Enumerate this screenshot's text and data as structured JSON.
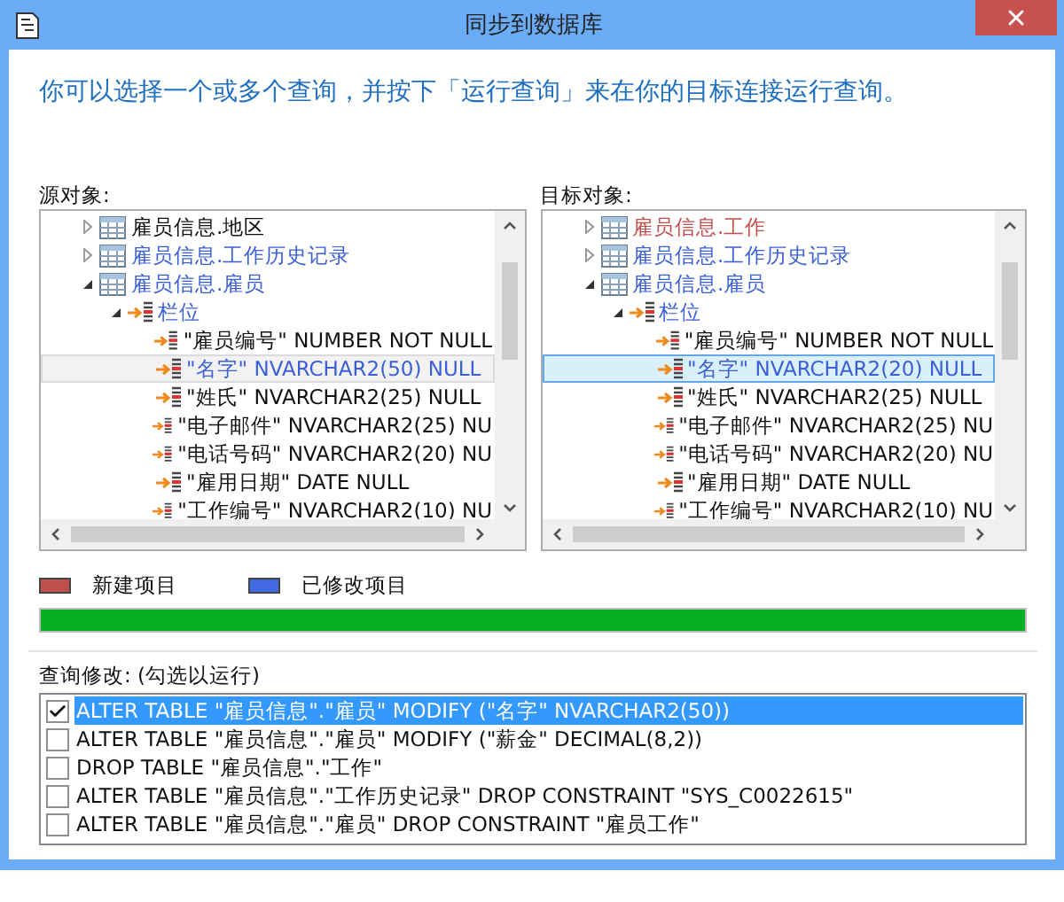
{
  "window": {
    "title": "同步到数据库"
  },
  "instruction": "你可以选择一个或多个查询，并按下「运行查询」来在你的目标连接运行查询。",
  "trees": [
    {
      "label": "源对象:",
      "focused": false,
      "nodes": [
        {
          "kind": "table",
          "label": "雇员信息.地区",
          "color": "#111111",
          "expanded": false,
          "selected": false
        },
        {
          "kind": "table",
          "label": "雇员信息.工作历史记录",
          "color": "#3b5fd6",
          "expanded": false,
          "selected": false
        },
        {
          "kind": "table",
          "label": "雇员信息.雇员",
          "color": "#3b5fd6",
          "expanded": true,
          "selected": false,
          "children": [
            {
              "kind": "group",
              "label": "栏位",
              "color": "#3b5fd6",
              "expanded": true,
              "selected": false,
              "children": [
                {
                  "kind": "field",
                  "label": "\"雇员编号\" NUMBER NOT NULL",
                  "color": "#111111",
                  "selected": false
                },
                {
                  "kind": "field",
                  "label": "\"名字\" NVARCHAR2(50) NULL",
                  "color": "#3b5fd6",
                  "selected": true
                },
                {
                  "kind": "field",
                  "label": "\"姓氏\" NVARCHAR2(25) NULL",
                  "color": "#111111",
                  "selected": false
                },
                {
                  "kind": "field",
                  "label": "\"电子邮件\" NVARCHAR2(25) NU",
                  "color": "#111111",
                  "selected": false
                },
                {
                  "kind": "field",
                  "label": "\"电话号码\" NVARCHAR2(20) NU",
                  "color": "#111111",
                  "selected": false
                },
                {
                  "kind": "field",
                  "label": "\"雇用日期\" DATE NULL",
                  "color": "#111111",
                  "selected": false
                },
                {
                  "kind": "field",
                  "label": "\"工作编号\" NVARCHAR2(10) NU",
                  "color": "#111111",
                  "selected": false
                }
              ]
            }
          ]
        }
      ]
    },
    {
      "label": "目标对象:",
      "focused": true,
      "nodes": [
        {
          "kind": "table",
          "label": "雇员信息.工作",
          "color": "#c0504d",
          "expanded": false,
          "selected": false
        },
        {
          "kind": "table",
          "label": "雇员信息.工作历史记录",
          "color": "#3b5fd6",
          "expanded": false,
          "selected": false
        },
        {
          "kind": "table",
          "label": "雇员信息.雇员",
          "color": "#3b5fd6",
          "expanded": true,
          "selected": false,
          "children": [
            {
              "kind": "group",
              "label": "栏位",
              "color": "#3b5fd6",
              "expanded": true,
              "selected": false,
              "children": [
                {
                  "kind": "field",
                  "label": "\"雇员编号\" NUMBER NOT NULL",
                  "color": "#111111",
                  "selected": false
                },
                {
                  "kind": "field",
                  "label": "\"名字\" NVARCHAR2(20) NULL",
                  "color": "#3b5fd6",
                  "selected": true
                },
                {
                  "kind": "field",
                  "label": "\"姓氏\" NVARCHAR2(25) NULL",
                  "color": "#111111",
                  "selected": false
                },
                {
                  "kind": "field",
                  "label": "\"电子邮件\" NVARCHAR2(25) NU",
                  "color": "#111111",
                  "selected": false
                },
                {
                  "kind": "field",
                  "label": "\"电话号码\" NVARCHAR2(20) NU",
                  "color": "#111111",
                  "selected": false
                },
                {
                  "kind": "field",
                  "label": "\"雇用日期\" DATE NULL",
                  "color": "#111111",
                  "selected": false
                },
                {
                  "kind": "field",
                  "label": "\"工作编号\" NVARCHAR2(10) NU",
                  "color": "#111111",
                  "selected": false
                }
              ]
            }
          ]
        }
      ]
    }
  ],
  "legend": [
    {
      "label": "新建项目",
      "color": "#c0504d"
    },
    {
      "label": "已修改项目",
      "color": "#4169e1"
    }
  ],
  "progress": {
    "level": 1
  },
  "queries": {
    "label": "查询修改: (勾选以运行)",
    "items": [
      {
        "text": "ALTER TABLE \"雇员信息\".\"雇员\" MODIFY (\"名字\" NVARCHAR2(50))",
        "checked": true,
        "selected": true
      },
      {
        "text": "ALTER TABLE \"雇员信息\".\"雇员\" MODIFY (\"薪金\" DECIMAL(8,2))",
        "checked": false,
        "selected": false
      },
      {
        "text": "DROP TABLE \"雇员信息\".\"工作\"",
        "checked": false,
        "selected": false
      },
      {
        "text": "ALTER TABLE \"雇员信息\".\"工作历史记录\" DROP CONSTRAINT \"SYS_C0022615\"",
        "checked": false,
        "selected": false
      },
      {
        "text": "ALTER TABLE \"雇员信息\".\"雇员\" DROP CONSTRAINT \"雇员工作\"",
        "checked": false,
        "selected": false
      }
    ]
  }
}
